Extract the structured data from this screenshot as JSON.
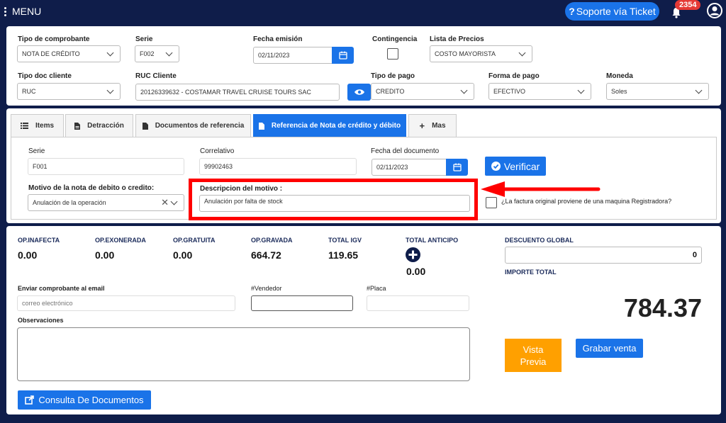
{
  "topbar": {
    "menu_label": "MENU",
    "ticket_label": "Soporte vía Ticket",
    "notifications_count": "2354"
  },
  "header": {
    "tipo_comprobante": {
      "label": "Tipo de comprobante",
      "value": "NOTA DE CRÉDITO"
    },
    "serie": {
      "label": "Serie",
      "value": "F002"
    },
    "fecha_emision": {
      "label": "Fecha emisión",
      "value": "02/11/2023"
    },
    "contingencia": {
      "label": "Contingencia"
    },
    "lista_precios": {
      "label": "Lista de Precios",
      "value": "COSTO MAYORISTA"
    },
    "tipo_doc_cliente": {
      "label": "Tipo doc cliente",
      "value": "RUC"
    },
    "ruc_cliente": {
      "label": "RUC Cliente",
      "value": "20126339632 - COSTAMAR TRAVEL CRUISE  TOURS SAC"
    },
    "tipo_pago": {
      "label": "Tipo de pago",
      "value": "CREDITO"
    },
    "forma_pago": {
      "label": "Forma de pago",
      "value": "EFECTIVO"
    },
    "moneda": {
      "label": "Moneda",
      "value": "Soles"
    }
  },
  "tabs": [
    {
      "label": "Items",
      "icon": "list-icon"
    },
    {
      "label": "Detracción",
      "icon": "document-icon"
    },
    {
      "label": "Documentos de referencia",
      "icon": "file-icon"
    },
    {
      "label": "Referencia de Nota de crédito y débito",
      "icon": "file-icon",
      "active": true
    },
    {
      "label": "Mas",
      "icon": "plus-icon"
    }
  ],
  "referencia": {
    "serie": {
      "label": "Serie",
      "value": "F001"
    },
    "correlativo": {
      "label": "Correlativo",
      "value": "99902463"
    },
    "fecha_documento": {
      "label": "Fecha del documento",
      "value": "02/11/2023"
    },
    "verificar_label": "Verificar",
    "motivo": {
      "label": "Motivo de la nota de debito o credito:",
      "value": "Anulación de la operación"
    },
    "descripcion": {
      "label": "Descripcion del motivo :",
      "value": "Anulación por falta de stock"
    },
    "registradora_label": "¿La factura original proviene de una maquina Registradora?"
  },
  "totals": {
    "items": [
      {
        "label": "OP.INAFECTA",
        "value": "0.00"
      },
      {
        "label": "OP.EXONERADA",
        "value": "0.00"
      },
      {
        "label": "OP.GRATUITA",
        "value": "0.00"
      },
      {
        "label": "OP.GRAVADA",
        "value": "664.72"
      },
      {
        "label": "TOTAL IGV",
        "value": "119.65"
      },
      {
        "label": "TOTAL ANTICIPO",
        "value": "0.00"
      }
    ],
    "descuento_label": "DESCUENTO GLOBAL",
    "descuento_value": "0",
    "importe_label": "IMPORTE TOTAL",
    "importe_value": "784.37"
  },
  "footer": {
    "email_label": "Enviar comprobante al email",
    "email_placeholder": "correo electrónico",
    "vendedor_label": "#Vendedor",
    "placa_label": "#Placa",
    "observaciones_label": "Observaciones",
    "vista_previa_label": "Vista Previa",
    "grabar_label": "Grabar venta",
    "consulta_label": "Consulta De Documentos"
  },
  "colors": {
    "navy": "#0f1d4a",
    "blue": "#1a73e8",
    "orange": "#ffa000",
    "red": "#e53935",
    "annotation_red": "#ff0000"
  }
}
